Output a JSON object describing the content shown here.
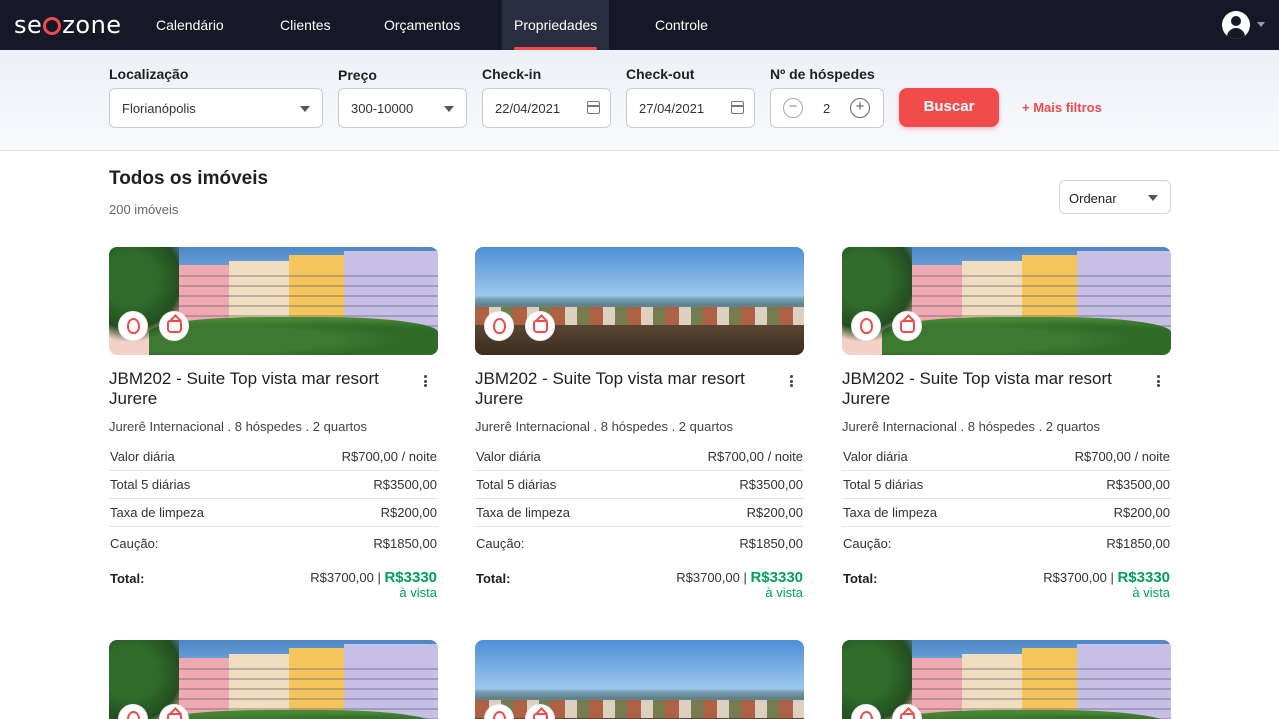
{
  "app": {
    "logo_text_left": "se",
    "logo_text_right": "zone",
    "accent_color": "#f24b4b",
    "success_color": "#00a35c"
  },
  "nav": {
    "items": [
      {
        "label": "Calendário",
        "active": false
      },
      {
        "label": "Clientes",
        "active": false
      },
      {
        "label": "Orçamentos",
        "active": false
      },
      {
        "label": "Propriedades",
        "active": true
      },
      {
        "label": "Controle",
        "active": false
      }
    ],
    "user_icon": "user-avatar-icon",
    "menu_icon": "chevron-down-icon"
  },
  "filters": {
    "location": {
      "label": "Localização",
      "value": "Florianópolis"
    },
    "price": {
      "label": "Preço",
      "value": "300-10000"
    },
    "checkin": {
      "label": "Check-in",
      "value": "22/04/2021"
    },
    "checkout": {
      "label": "Check-out",
      "value": "27/04/2021"
    },
    "guests": {
      "label": "Nº de hóspedes",
      "value": "2",
      "minus": "−",
      "plus": "+"
    },
    "search_button": "Buscar",
    "more_filters": "+ Mais filtros"
  },
  "listing": {
    "title": "Todos os imóveis",
    "count": "200 imóveis",
    "sort_label": "Ordenar"
  },
  "cards": [
    {
      "title": "JBM202 - Suite Top vista mar resort Jurere",
      "subtitle": "Jurerê Internacional . 8 hóspedes . 2 quartos",
      "rows": [
        {
          "label": "Valor diária",
          "value": "R$700,00 / noite"
        },
        {
          "label": "Total 5 diárias",
          "value": "R$3500,00"
        },
        {
          "label": "Taxa de limpeza",
          "value": "R$200,00"
        },
        {
          "label": "Caução:",
          "value": "R$1850,00"
        }
      ],
      "total_label": "Total:",
      "total_full": "R$3700,00 | ",
      "total_discount": "R$3330",
      "total_note": "à vista"
    },
    {
      "title": "JBM202 - Suite Top vista mar resort Jurere",
      "subtitle": "Jurerê Internacional . 8 hóspedes . 2 quartos",
      "rows": [
        {
          "label": "Valor diária",
          "value": "R$700,00 / noite"
        },
        {
          "label": "Total 5 diárias",
          "value": "R$3500,00"
        },
        {
          "label": "Taxa de limpeza",
          "value": "R$200,00"
        },
        {
          "label": "Caução:",
          "value": "R$1850,00"
        }
      ],
      "total_label": "Total:",
      "total_full": "R$3700,00 | ",
      "total_discount": "R$3330",
      "total_note": "à vista"
    },
    {
      "title": "JBM202 - Suite Top vista mar resort Jurere",
      "subtitle": "Jurerê Internacional . 8 hóspedes . 2 quartos",
      "rows": [
        {
          "label": "Valor diária",
          "value": "R$700,00 / noite"
        },
        {
          "label": "Total 5 diárias",
          "value": "R$3500,00"
        },
        {
          "label": "Taxa de limpeza",
          "value": "R$200,00"
        },
        {
          "label": "Caução:",
          "value": "R$1850,00"
        }
      ],
      "total_label": "Total:",
      "total_full": "R$3700,00 | ",
      "total_discount": "R$3330",
      "total_note": "à vista"
    }
  ]
}
